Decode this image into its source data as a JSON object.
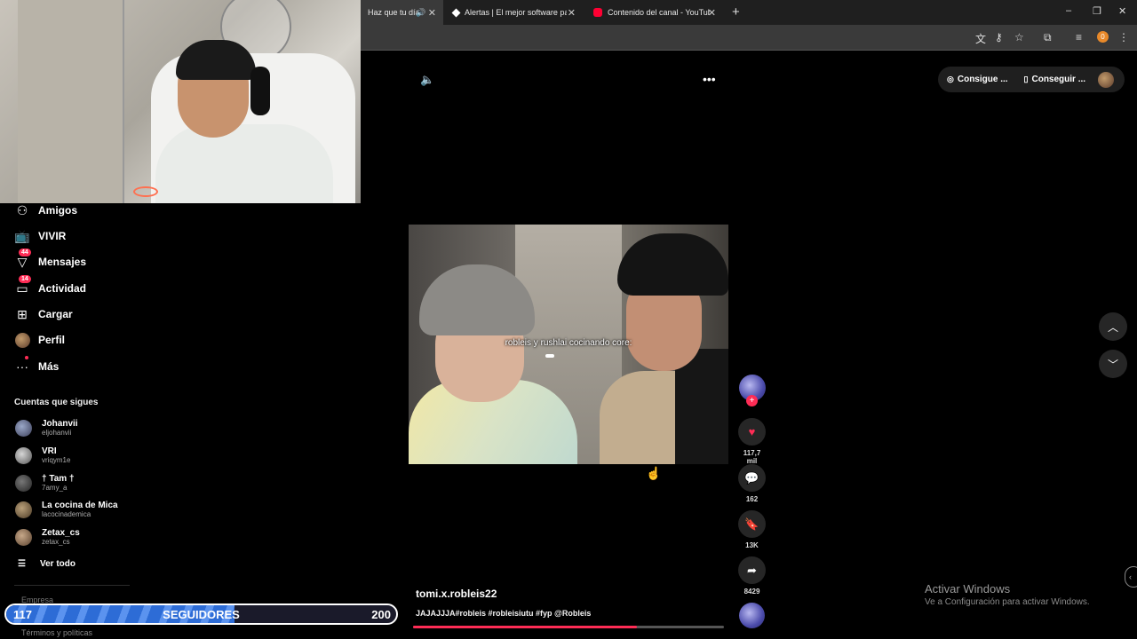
{
  "browser": {
    "tabs": [
      {
        "label": "Haz que tu día",
        "active": true
      },
      {
        "label": "Alertas | El mejor software para"
      },
      {
        "label": "Contenido del canal - YouTube"
      }
    ],
    "new_tab_glyph": "+",
    "window_controls": [
      "–",
      "❐",
      "✕"
    ],
    "profile_initial": "0"
  },
  "sidebar": {
    "items": [
      {
        "label": "Amigos",
        "icon": "friends-icon"
      },
      {
        "label": "VIVIR",
        "icon": "live-icon"
      },
      {
        "label": "Mensajes",
        "icon": "messages-icon",
        "badge": "44"
      },
      {
        "label": "Actividad",
        "icon": "activity-icon",
        "badge": "14"
      },
      {
        "label": "Cargar",
        "icon": "upload-icon"
      },
      {
        "label": "Perfil",
        "icon": "profile-avatar"
      },
      {
        "label": "Más",
        "icon": "more-icon"
      }
    ],
    "following_title": "Cuentas que sigues",
    "following": [
      {
        "name": "Johanvii",
        "user": "eljohanvii"
      },
      {
        "name": "VRI",
        "user": "vriqym1e"
      },
      {
        "name": "† Tam †",
        "user": "7amy_a"
      },
      {
        "name": "La cocina de Mica",
        "user": "lacocinademica"
      },
      {
        "name": "Zetax_cs",
        "user": "zetax_cs"
      }
    ],
    "see_all": "Ver todo",
    "footer": [
      "Empresa",
      "Términos y políticas"
    ]
  },
  "overlay": {
    "current": "117",
    "label": "SEGUIDORES",
    "goal": "200",
    "progress_fraction": 0.585
  },
  "topbar": {
    "get_coins": "Consigue ...",
    "get_app": "Conseguir ..."
  },
  "video": {
    "caption": "robleis y rushlai cocinando core:",
    "author": "tomi.x.robleis22",
    "description": "JAJAJJJA#robleis #robleisiutu #fyp @Robleis",
    "progress_fraction": 0.72
  },
  "actions": {
    "likes": "117,7 mil",
    "comments": "162",
    "saves": "13K",
    "shares": "8429"
  },
  "watermark": {
    "line1": "Activar Windows",
    "line2": "Ve a Configuración para activar Windows."
  },
  "colors": {
    "accent": "#fe2c55",
    "bar_blue": "#2d6cd6"
  }
}
